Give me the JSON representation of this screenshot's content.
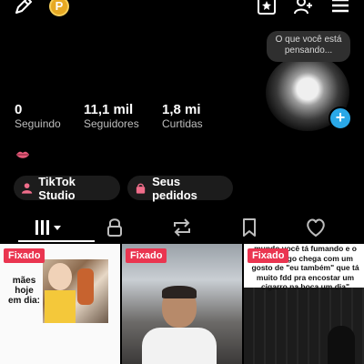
{
  "header": {
    "coin_letter": "P",
    "icons": [
      "edit-icon",
      "coin-icon",
      "bookmark-star-icon",
      "add-user-icon",
      "menu-icon"
    ]
  },
  "profile": {
    "thought_bubble": "O que você está pensando...",
    "avatar_badge": "+"
  },
  "stats": [
    {
      "value": "0",
      "label": "Seguindo"
    },
    {
      "value": "11,1 mil",
      "label": "Seguidores"
    },
    {
      "value": "1,8 mi",
      "label": "Curtidas"
    }
  ],
  "buttons": {
    "tiktok_studio": "TikTok Studio",
    "seus_pedidos": "Seus pedidos"
  },
  "tabs": [
    "videos-tab",
    "private-tab",
    "reposts-tab",
    "saved-tab",
    "liked-tab"
  ],
  "grid": [
    {
      "badge": "Fixado",
      "overlay_text": "mães hoje em dia:"
    },
    {
      "badge": "Fixado"
    },
    {
      "badge": "Fixado",
      "caption": "mundo você tá fumando e o Seu amigo chega com um gosto de \"eu também\" que tá muito fdd pra encostar um cigarro na boca um dia\""
    }
  ],
  "colors": {
    "badge": "#ea3550",
    "coin": "#e7a923",
    "plus_badge": "#2aa8e8",
    "pill_bg": "#1c1c1c",
    "pill_icon": "#f06d8a"
  }
}
